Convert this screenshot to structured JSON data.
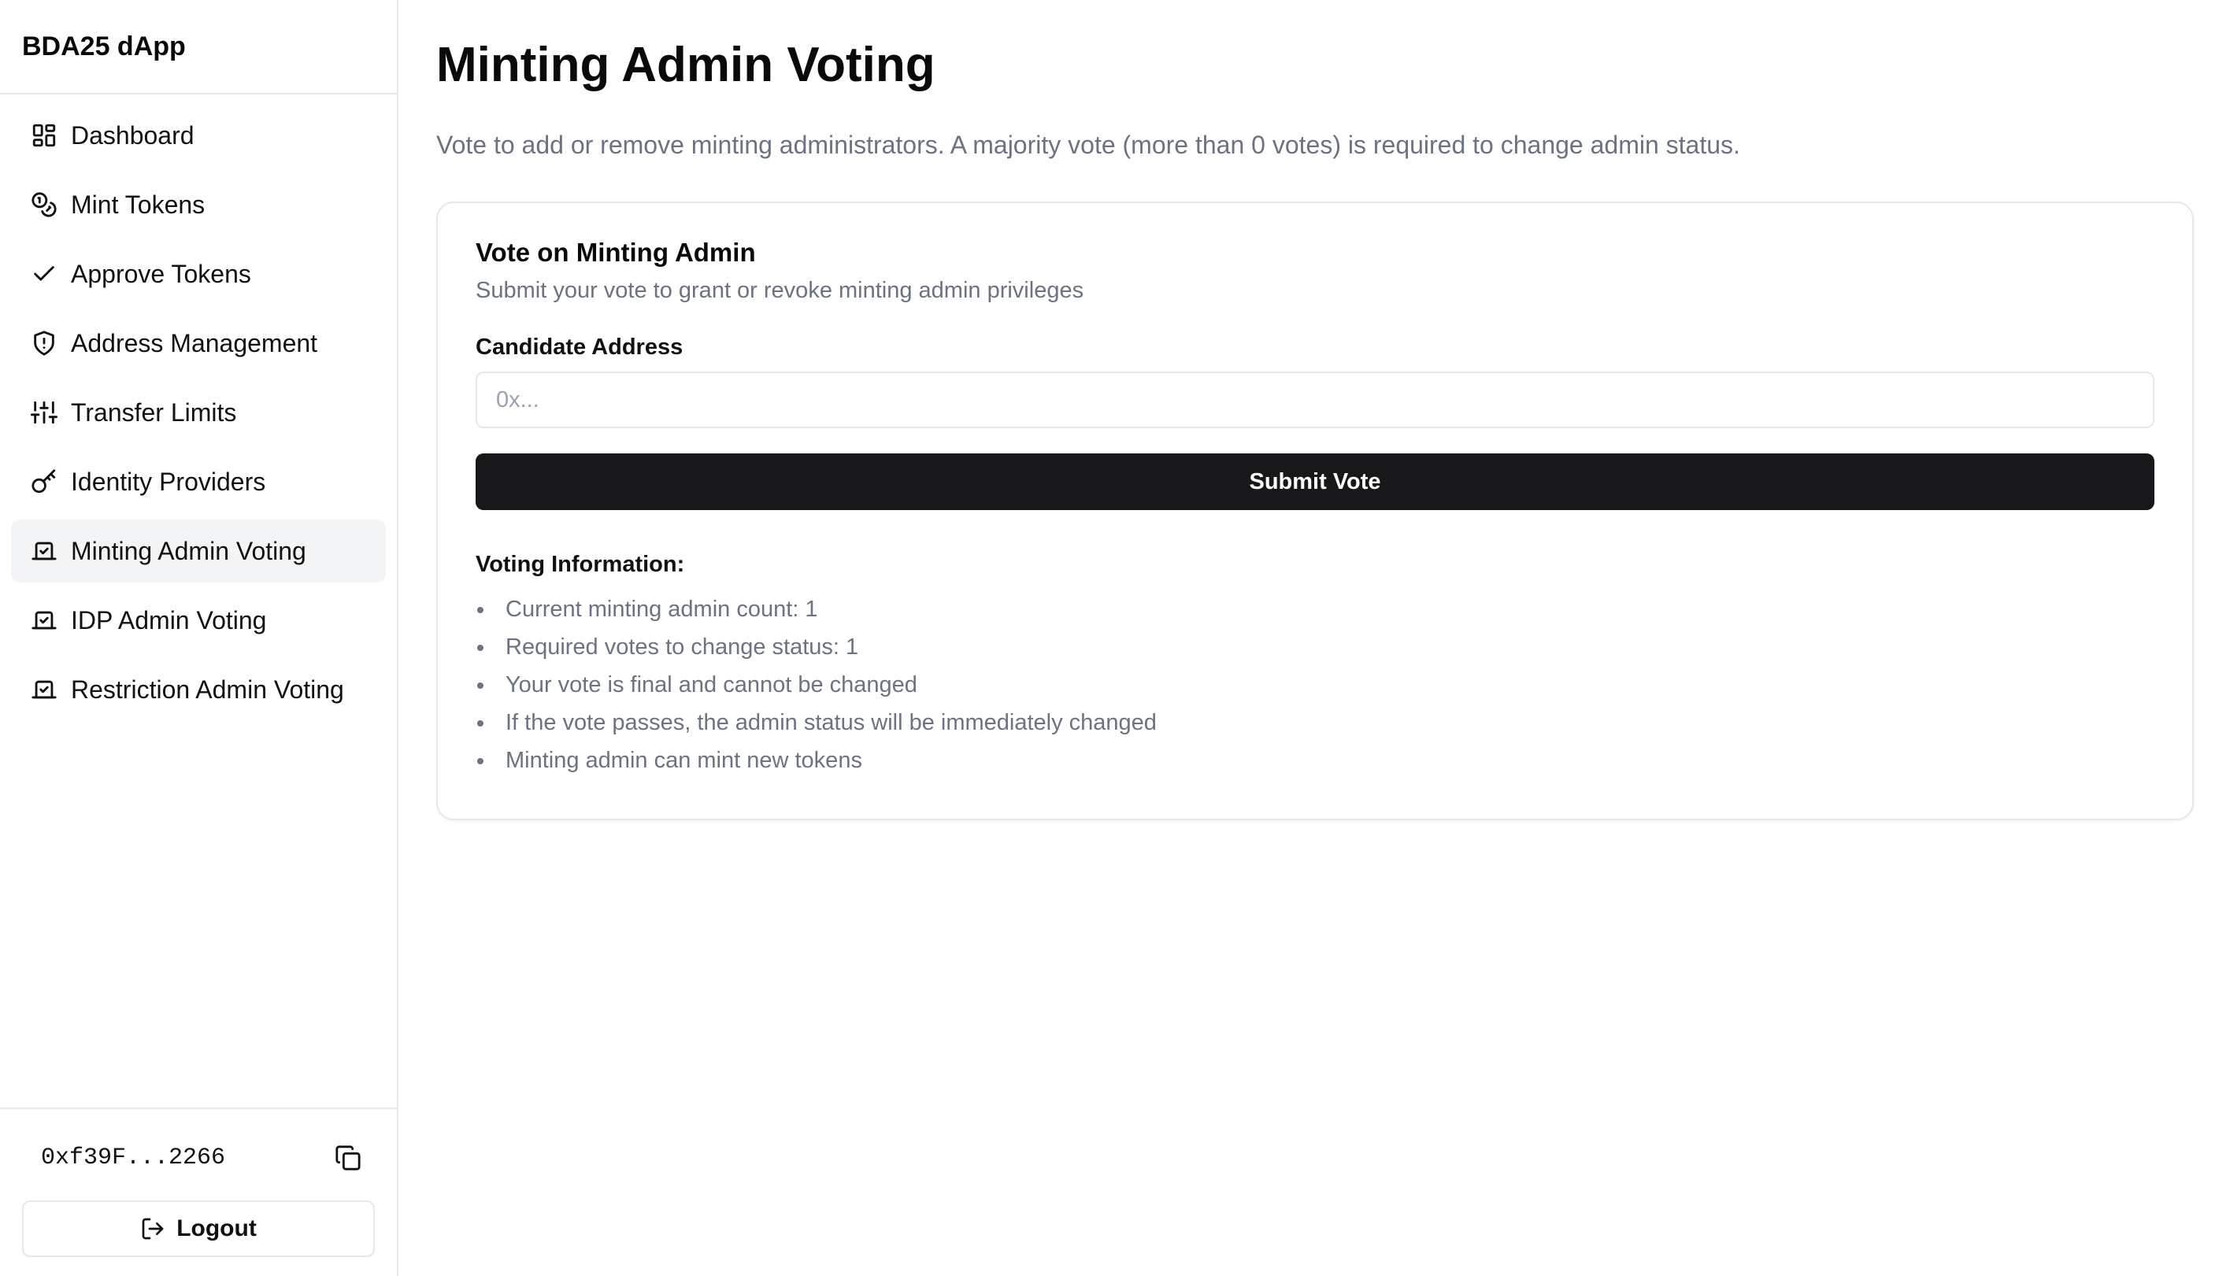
{
  "sidebar": {
    "brand": "BDA25 dApp",
    "items": [
      {
        "label": "Dashboard",
        "icon": "dashboard-icon"
      },
      {
        "label": "Mint Tokens",
        "icon": "coins-icon"
      },
      {
        "label": "Approve Tokens",
        "icon": "check-icon"
      },
      {
        "label": "Address Management",
        "icon": "shield-icon"
      },
      {
        "label": "Transfer Limits",
        "icon": "sliders-icon"
      },
      {
        "label": "Identity Providers",
        "icon": "key-icon"
      },
      {
        "label": "Minting Admin Voting",
        "icon": "vote-icon",
        "active": true
      },
      {
        "label": "IDP Admin Voting",
        "icon": "vote-icon"
      },
      {
        "label": "Restriction Admin Voting",
        "icon": "vote-icon"
      }
    ],
    "wallet_address": "0xf39F...2266",
    "logout_label": "Logout"
  },
  "main": {
    "title": "Minting Admin Voting",
    "description": "Vote to add or remove minting administrators. A majority vote (more than 0 votes) is required to change admin status.",
    "card": {
      "title": "Vote on Minting Admin",
      "description": "Submit your vote to grant or revoke minting admin privileges",
      "field_label": "Candidate Address",
      "field_placeholder": "0x...",
      "field_value": "",
      "submit_label": "Submit Vote",
      "info_title": "Voting Information:",
      "info_items": [
        "Current minting admin count: 1",
        "Required votes to change status: 1",
        "Your vote is final and cannot be changed",
        "If the vote passes, the admin status will be immediately changed",
        "Minting admin can mint new tokens"
      ]
    }
  },
  "colors": {
    "primary_button": "#18181b",
    "active_nav_bg": "#f3f4f6",
    "muted_text": "#6b7280",
    "border": "#e5e7eb"
  }
}
